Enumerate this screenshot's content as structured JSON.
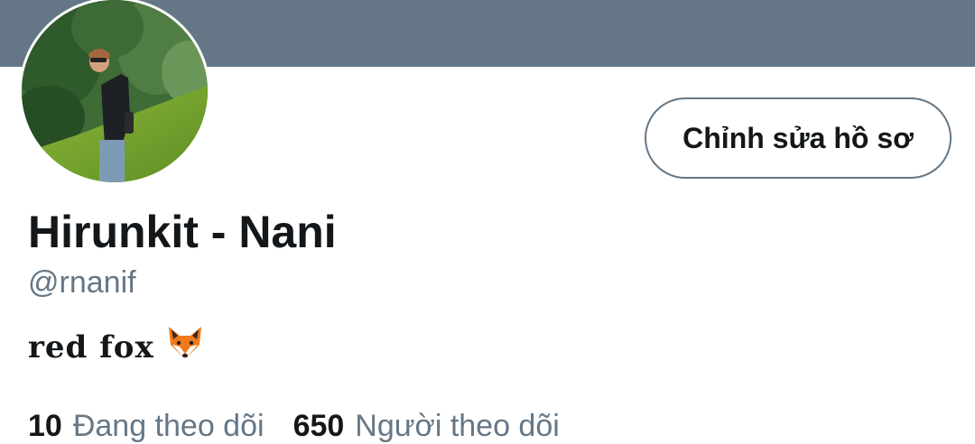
{
  "profile": {
    "display_name": "Hirunkit - Nani",
    "handle": "@rnanif",
    "bio_text": "red fox",
    "bio_emoji": "fox-face-icon"
  },
  "actions": {
    "edit_profile_label": "Chỉnh sửa hồ sơ"
  },
  "stats": {
    "following_count": "10",
    "following_label": "Đang theo dõi",
    "followers_count": "650",
    "followers_label": "Người theo dõi"
  },
  "colors": {
    "banner": "#657786",
    "secondary_text": "#657786",
    "primary_text": "#14171a"
  }
}
